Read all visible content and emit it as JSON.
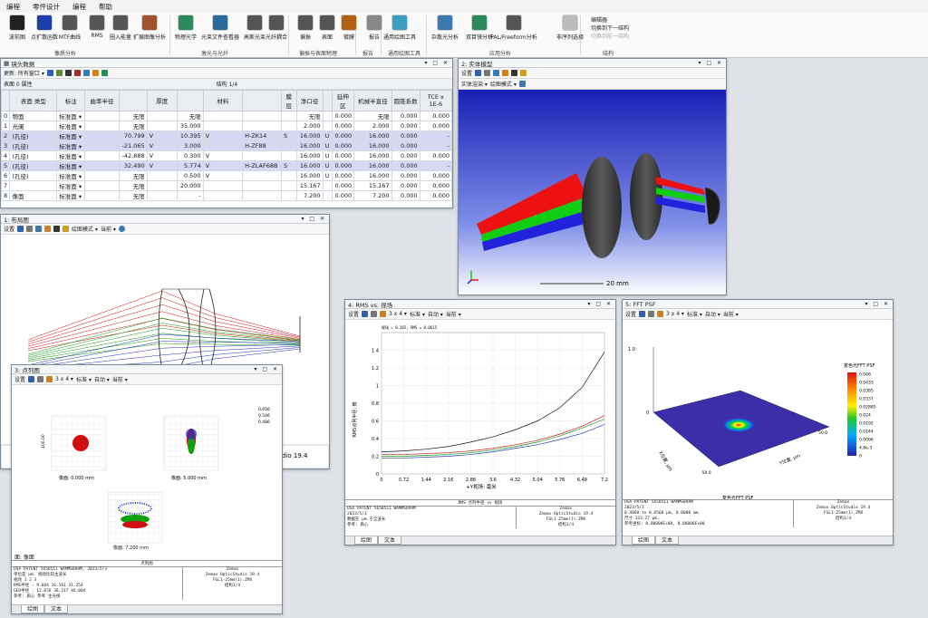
{
  "menu": [
    "编程",
    "零件设计",
    "编程",
    "帮助"
  ],
  "ribbon": {
    "buttons": [
      {
        "label": "波前图",
        "color": "#222"
      },
      {
        "label": "点扩散函数",
        "color": "#1e3fa8"
      },
      {
        "label": "MTF曲线",
        "color": "#555"
      },
      {
        "label": "RMS",
        "color": "#555"
      },
      {
        "label": "圈入能量",
        "color": "#555"
      },
      {
        "label": "扩展图像分析",
        "color": "#a0522d"
      },
      {
        "label": "物理光学",
        "color": "#2a8a5a"
      },
      {
        "label": "光束文件查看器",
        "color": "#2a6a9a"
      },
      {
        "label": "高斯光束",
        "color": "#555"
      },
      {
        "label": "光纤耦合",
        "color": "#555"
      },
      {
        "label": "偏振",
        "color": "#555"
      },
      {
        "label": "表面",
        "color": "#555"
      },
      {
        "label": "镀膜",
        "color": "#b06010"
      },
      {
        "label": "报告",
        "color": "#888"
      },
      {
        "label": "通用绘图工具",
        "color": "#3aa0c0"
      },
      {
        "label": "杂散光分析",
        "color": "#3a7ab0"
      },
      {
        "label": "双目镜分析",
        "color": "#2a8a5a"
      },
      {
        "label": "PAL/Freeform分析",
        "color": "#555"
      },
      {
        "label": "非序列选择",
        "color": "#bbb"
      }
    ],
    "groups": [
      "像质分析",
      "激光与光纤",
      "偏振与表面物理",
      "报告",
      "通用绘图工具",
      "应用分析",
      "结构"
    ],
    "right_items": [
      "编辑器",
      "切换到下一结构",
      "切换到前一结构"
    ]
  },
  "lens": {
    "title": "镜头数据",
    "update_label": "更新: 所有窗口 ▾",
    "surface_label": "表面 0 属性",
    "config": "结构 1/4",
    "headers": [
      "",
      "表面 类型",
      "标注",
      "曲率半径",
      "",
      "厚度",
      "",
      "材料",
      "",
      "膜层",
      "净口径",
      "",
      "延伸区",
      "机械半直径",
      "圆锥系数",
      "TCE x 1E-6"
    ],
    "rows": [
      [
        "0",
        "物面",
        "标准面 ▾",
        "",
        "无限",
        "",
        "无限",
        "",
        "",
        "",
        "无限",
        "",
        "0.000",
        "无限",
        "0.000",
        "0.000"
      ],
      [
        "1",
        "光阑",
        "标准面 ▾",
        "",
        "无限",
        "",
        "35.000",
        "",
        "",
        "",
        "2.000",
        "",
        "0.000",
        "2.000",
        "0.000",
        "0.000"
      ],
      [
        "2",
        "(孔径)",
        "标准面 ▾",
        "",
        "70.799",
        "V",
        "10.395",
        "V",
        "H-ZK14",
        "S",
        "16.000",
        "U",
        "0.000",
        "16.000",
        "0.000",
        "-"
      ],
      [
        "3",
        "(孔径)",
        "标准面 ▾",
        "",
        "-21.065",
        "V",
        "3.000",
        "",
        "H-ZF88",
        "",
        "16.000",
        "U",
        "0.000",
        "16.000",
        "0.000",
        "-"
      ],
      [
        "4",
        "(孔径)",
        "标准面 ▾",
        "",
        "-42.888",
        "V",
        "0.300",
        "V",
        "",
        "",
        "16.000",
        "U",
        "0.000",
        "16.000",
        "0.000",
        "0.000"
      ],
      [
        "5",
        "(孔径)",
        "标准面 ▾",
        "",
        "32.490",
        "V",
        "5.774",
        "V",
        "H-ZLAF68B",
        "S",
        "16.000",
        "U",
        "0.000",
        "16.000",
        "0.000",
        "-"
      ],
      [
        "6",
        "(孔径)",
        "标准面 ▾",
        "",
        "无限",
        "",
        "0.500",
        "V",
        "",
        "",
        "16.000",
        "U",
        "0.000",
        "16.000",
        "0.000",
        "0.000"
      ],
      [
        "7",
        "",
        "标准面 ▾",
        "",
        "无限",
        "",
        "20.000",
        "",
        "",
        "",
        "15.167",
        "",
        "0.000",
        "15.167",
        "0.000",
        "0.000"
      ],
      [
        "8",
        "像面",
        "标准面 ▾",
        "",
        "无限",
        "",
        "-",
        "",
        "",
        "",
        "7.200",
        "",
        "0.000",
        "7.200",
        "0.000",
        "0.000"
      ]
    ]
  },
  "layout": {
    "title": "1: 布局图",
    "toolbar_settings": "设置",
    "draw_mode": "绘图模式 ▾",
    "current": "当前 ▾",
    "foot": "dio 19.4"
  },
  "shaded": {
    "title": "2: 实体模型",
    "toolbar_settings": "设置",
    "entity_label": "实体渲染 ▾",
    "draw_mode": "绘图模式 ▾",
    "scale": "20 mm"
  },
  "spot": {
    "title": "3: 点列图",
    "toolbar_settings": "设置",
    "grid": "3 x 4 ▾",
    "std": "标准 ▾",
    "auto": "自动 ▾",
    "current": "当前 ▾",
    "legend": [
      "0.656",
      "0.546",
      "0.486"
    ],
    "fields": [
      "像面: 0.000 mm",
      "像面: 5.000 mm",
      "像面: 7.200 mm"
    ],
    "axis": "100.00",
    "surface": "面: 像面",
    "foot_title": "点列图",
    "foot_left": [
      "USA   PATENT 5650511  WAMMS09AM, 2023/5/3",
      "单位是 μm. 视场比较主波长",
      "视场            1       2       3",
      "RMS半径  :  9.684  16.161  31.254",
      "GEO半径  : 12.076  36.217  46.004",
      "参考: 质心      参考    主光线"
    ],
    "foot_right": [
      "Zemax",
      "Zemax OpticStudio 19.4",
      "",
      "FGL1-25mm(1).ZMX",
      "结构1/4"
    ],
    "tabs": [
      "绘图",
      "文本"
    ]
  },
  "rms": {
    "title": "4: RMS vs. 视场",
    "toolbar_settings": "设置",
    "grid": "3 x 4 ▾",
    "std": "标准 ▾",
    "auto": "自动 ▾",
    "current": "当前 ▾",
    "legend_top": "视场 = 0.365, RMS = 0.0615",
    "legend_bottom": [
      "多色性",
      "0.6560",
      "0.5460",
      "0.4860"
    ],
    "foot_title": "RMS 点列半径 vs 视场",
    "foot_left": [
      "USA   PATENT 5650511  WAMMS09AM",
      "2023/5/3",
      "数据在 μm 于全波长",
      "参考: 质心"
    ],
    "foot_right": [
      "Zemax",
      "Zemax OpticStudio 19.4",
      "",
      "FGL1-25mm(1).ZMX",
      "结构1/4"
    ],
    "tabs": [
      "绘图",
      "文本"
    ]
  },
  "psf": {
    "title": "5: FFT PSF",
    "toolbar_settings": "设置",
    "grid": "3 x 4 ▾",
    "std": "标准 ▾",
    "auto": "自动 ▾",
    "current": "当前 ▾",
    "zlabel_top": "1.0",
    "zlabel_bottom": "0",
    "xaxis_label": "X位置, μm",
    "yaxis_label": "Y位置, μm",
    "colorbar_title": "复色光FFT PSF",
    "plot_caption": "复色光FFT PSF",
    "tick_pos": "50.0",
    "tick_neg": "-50.0",
    "colorbar_ticks": [
      "0.048",
      "0.0433",
      "0.0385",
      "0.0337",
      "0.02885",
      "0.024",
      "0.0192",
      "0.0144",
      "0.0096",
      "4.8e-3",
      "0"
    ],
    "foot_left": [
      "USA   PATENT 5650511  WAMMS09AM",
      "2023/5/3",
      "0.4860 to 0.6560 μm, 0.0000 mm.",
      "尺寸 133.27 μm.",
      "参考坐标: 0.00000E+00, 0.00000E+00"
    ],
    "foot_right": [
      "Zemax",
      "Zemax OpticStudio 19.4",
      "",
      "FGL1-25mm(1).ZMX",
      "结构1/4"
    ],
    "tabs": [
      "绘图",
      "文本"
    ]
  },
  "chart_data": {
    "type": "line",
    "title": "",
    "xlabel": "+Y视场: 毫米",
    "ylabel": "RMS点列半径: 微",
    "x_ticks": [
      "0",
      "0.72",
      "1.44",
      "2.16",
      "2.88",
      "3.6",
      "4.32",
      "5.04",
      "5.76",
      "6.48",
      "7.2"
    ],
    "y_ticks": [
      "0",
      "0.2",
      "0.4",
      "0.6",
      "0.8",
      "1",
      "1.2",
      "1.4"
    ],
    "xlim": [
      0,
      7.2
    ],
    "ylim": [
      0,
      1.6
    ],
    "x": [
      0,
      0.72,
      1.44,
      2.16,
      2.88,
      3.6,
      4.32,
      5.04,
      5.76,
      6.48,
      7.2
    ],
    "series": [
      {
        "name": "多色性",
        "color": "#111111",
        "values": [
          0.25,
          0.26,
          0.28,
          0.31,
          0.36,
          0.42,
          0.5,
          0.6,
          0.75,
          0.98,
          1.38
        ]
      },
      {
        "name": "0.6560",
        "color": "#1a9a1a",
        "values": [
          0.2,
          0.2,
          0.21,
          0.22,
          0.24,
          0.27,
          0.31,
          0.36,
          0.43,
          0.52,
          0.62
        ]
      },
      {
        "name": "0.5460",
        "color": "#c81e1e",
        "values": [
          0.22,
          0.22,
          0.23,
          0.24,
          0.26,
          0.29,
          0.33,
          0.38,
          0.45,
          0.54,
          0.66
        ]
      },
      {
        "name": "0.4860",
        "color": "#2040c0",
        "values": [
          0.18,
          0.18,
          0.19,
          0.2,
          0.22,
          0.25,
          0.29,
          0.33,
          0.39,
          0.46,
          0.56
        ]
      }
    ],
    "grid": true
  }
}
